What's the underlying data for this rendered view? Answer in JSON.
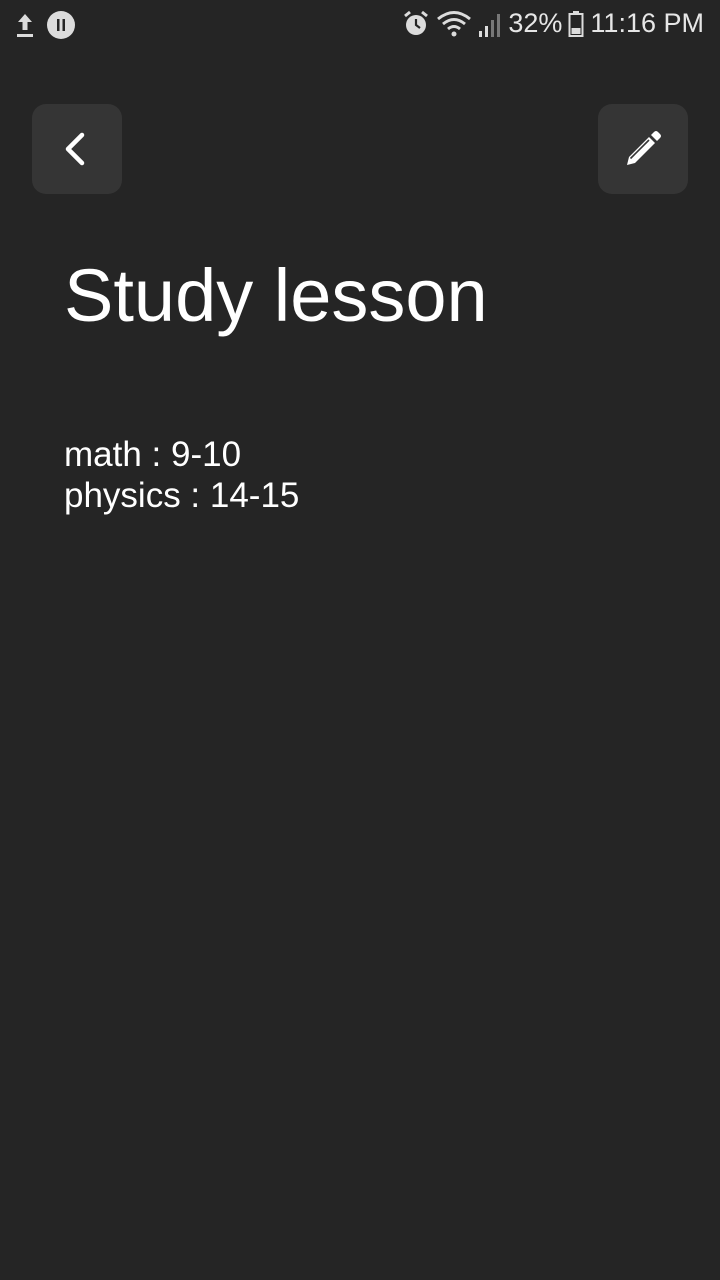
{
  "status_bar": {
    "battery_percent": "32%",
    "time": "11:16 PM",
    "icons": [
      "upload-icon",
      "app-notification-icon",
      "alarm-icon",
      "wifi-icon",
      "signal-icon",
      "battery-icon"
    ]
  },
  "header": {
    "back_icon": "chevron-left-icon",
    "edit_icon": "pencil-icon"
  },
  "note": {
    "title": "Study lesson",
    "lines": [
      "math : 9-10",
      "physics : 14-15"
    ]
  },
  "colors": {
    "background": "#252525",
    "button_background": "#353535",
    "text": "#ffffff"
  }
}
